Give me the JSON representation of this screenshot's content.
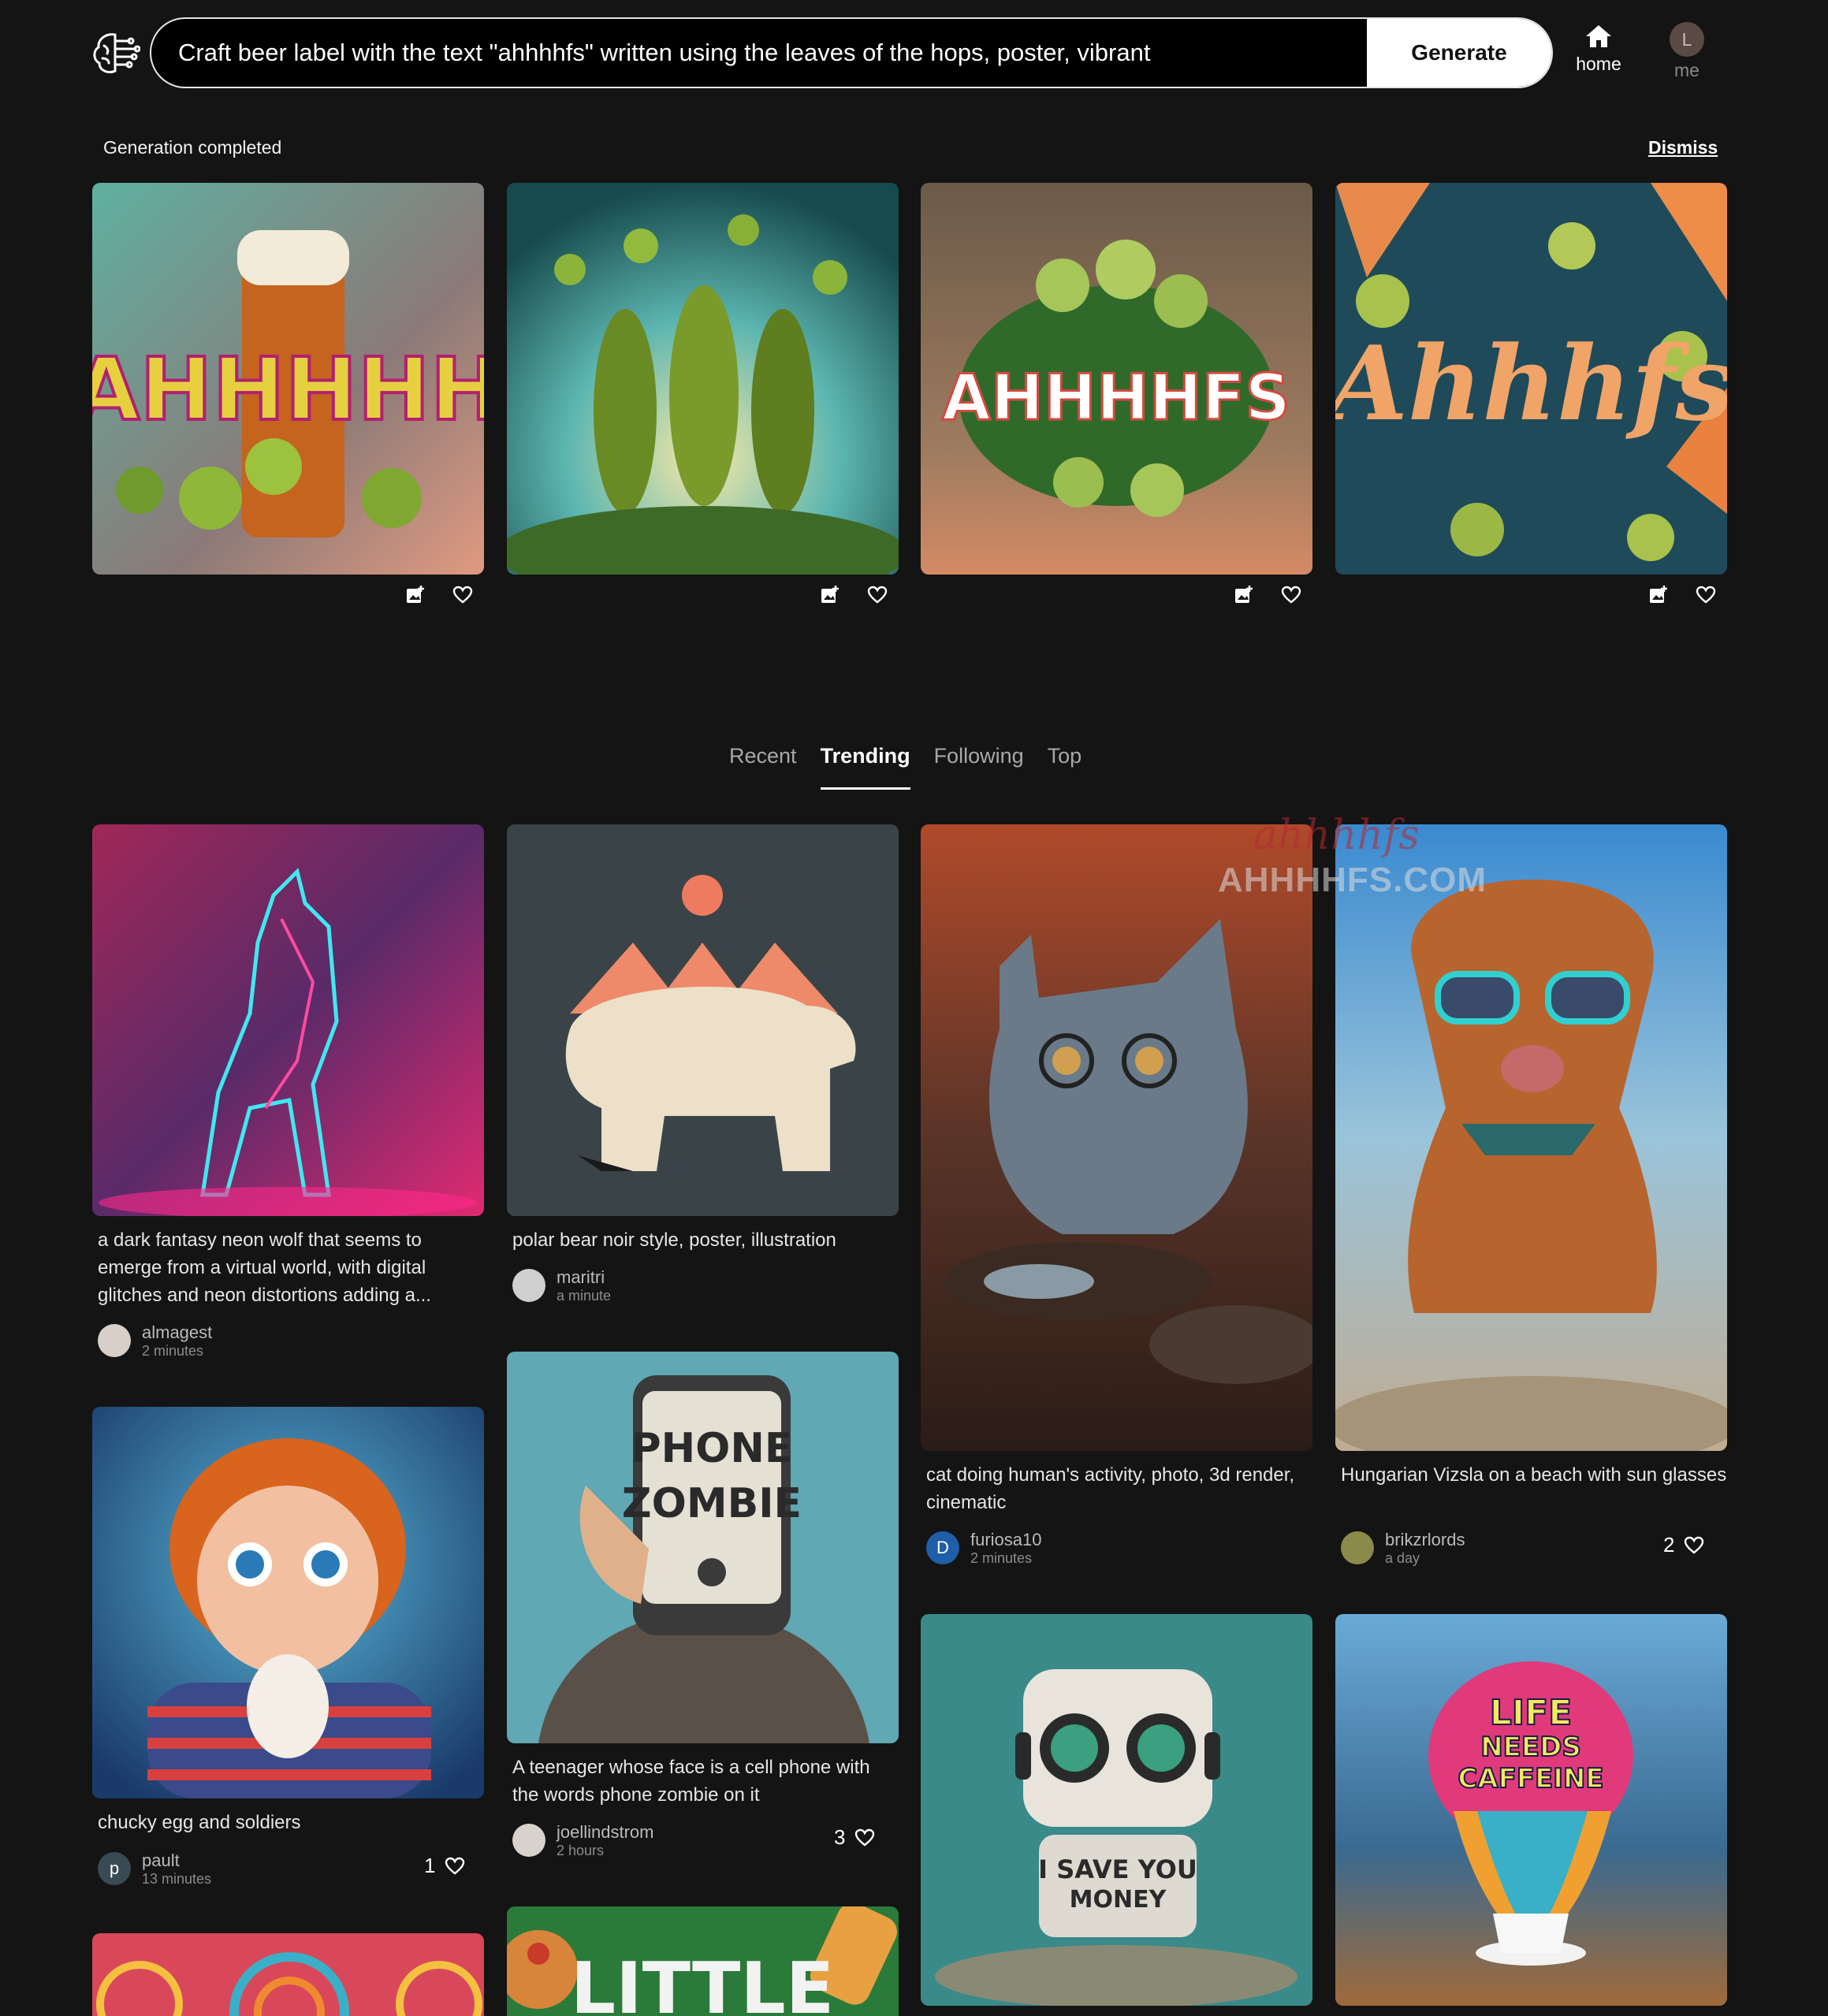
{
  "header": {
    "prompt_value": "Craft beer label with the text \"ahhhhfs\" written using the leaves of the hops, poster, vibrant",
    "generate_label": "Generate",
    "home_label": "home",
    "me_label": "me",
    "me_initial": "L"
  },
  "generation": {
    "status": "Generation completed",
    "dismiss_label": "Dismiss"
  },
  "tabs": [
    "Recent",
    "Trending",
    "Following",
    "Top"
  ],
  "active_tab": "Trending",
  "feed": {
    "wolf": {
      "caption": "a dark fantasy neon wolf that seems to emerge from a virtual world, with digital glitches and neon distortions adding a...",
      "user": "almagest",
      "time": "2 minutes"
    },
    "bear": {
      "caption": "polar bear noir style, poster, illustration",
      "user": "maritri",
      "time": "a minute"
    },
    "cat": {
      "caption": "cat doing human's activity, photo, 3d render, cinematic",
      "user": "furiosa10",
      "user_initial": "D",
      "time": "2 minutes"
    },
    "dog": {
      "caption": "Hungarian Vizsla on a beach with sun glasses",
      "user": "brikzrlords",
      "time": "a day",
      "likes": "2"
    },
    "chucky": {
      "caption": "chucky egg and soldiers",
      "user": "pault",
      "user_initial": "p",
      "time": "13 minutes",
      "likes": "1"
    },
    "phone": {
      "caption": "A teenager whose face is a cell phone with the words phone zombie on it",
      "user": "joellindstrom",
      "time": "2 hours",
      "likes": "3"
    }
  },
  "image_text": {
    "gen1": "AHHHHH",
    "gen3": "AHHHHFS",
    "gen4": "Ahhhfs",
    "phone_line1": "PHONE",
    "phone_line2": "ZOMBIE",
    "robot_line1": "I SAVE YOU",
    "robot_line2": "MONEY",
    "caffeine_line1": "LIFE",
    "caffeine_line2": "NEEDS",
    "caffeine_line3": "CAFFEINE",
    "little": "LITTLE"
  },
  "watermark": {
    "text1": "ahhhhfs",
    "text2": "AHHHHFS.COM"
  },
  "colors": {
    "background": "#141414",
    "accent": "#ffffff",
    "muted": "#a8a8a8"
  }
}
